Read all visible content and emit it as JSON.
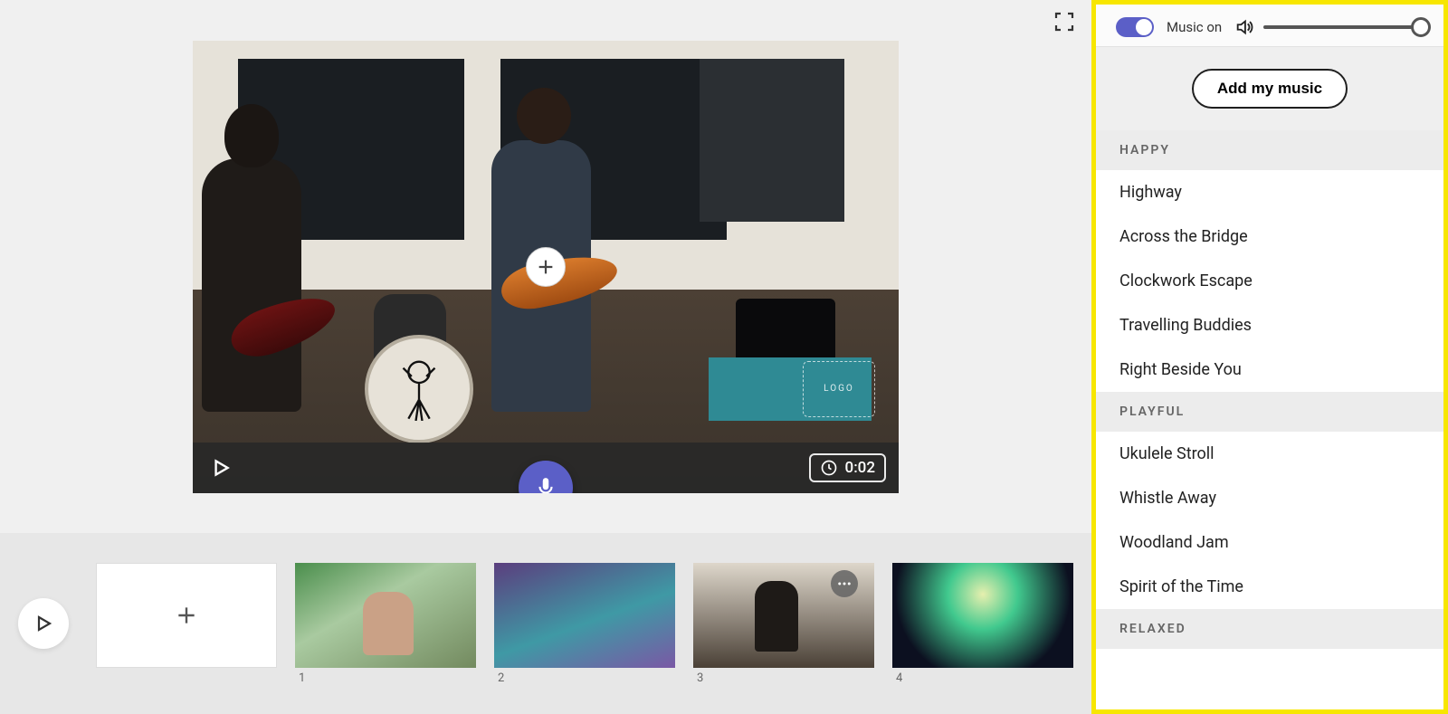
{
  "player": {
    "add_media_label": "+",
    "logo_placeholder": "LOGO",
    "duration": "0:02"
  },
  "timeline": {
    "add_tile_label": "+",
    "clips": [
      {
        "index": "1"
      },
      {
        "index": "2"
      },
      {
        "index": "3",
        "has_more_menu": true
      },
      {
        "index": "4"
      }
    ]
  },
  "music_panel": {
    "toggle_label": "Music on",
    "toggle_on": true,
    "volume_percent": 100,
    "add_music_label": "Add my music",
    "categories": [
      {
        "name": "HAPPY",
        "tracks": [
          "Highway",
          "Across the Bridge",
          "Clockwork Escape",
          "Travelling Buddies",
          "Right Beside You"
        ]
      },
      {
        "name": "PLAYFUL",
        "tracks": [
          "Ukulele Stroll",
          "Whistle Away",
          "Woodland Jam",
          "Spirit of the Time"
        ]
      },
      {
        "name": "RELAXED",
        "tracks": []
      }
    ]
  }
}
